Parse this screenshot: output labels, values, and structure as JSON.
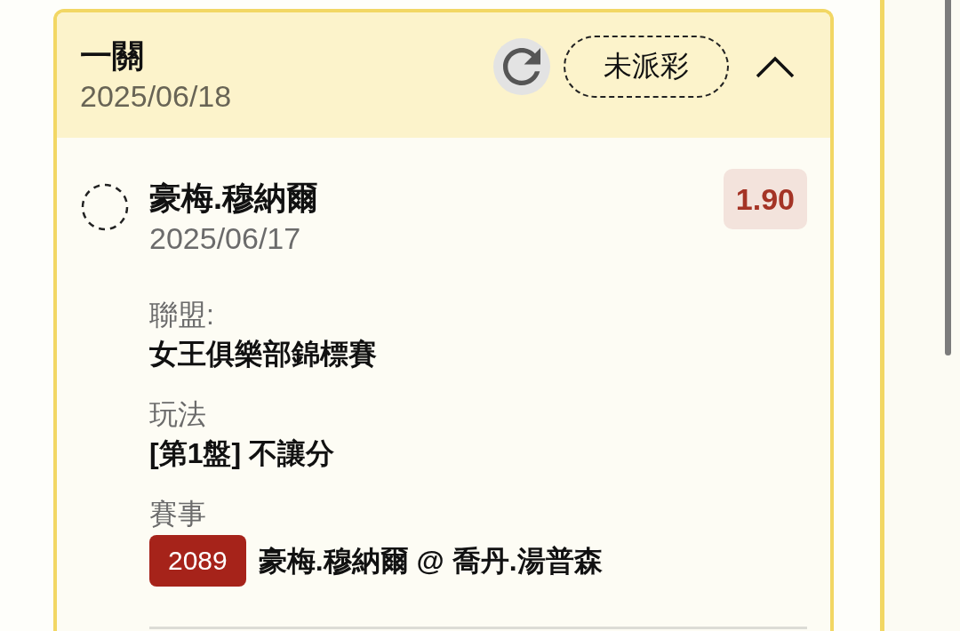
{
  "bet": {
    "type": "一關",
    "date": "2025/06/18",
    "status": "未派彩",
    "expanded": true
  },
  "selections": [
    {
      "name": "豪梅.穆納爾",
      "date": "2025/06/17",
      "odds": "1.90",
      "settled": false,
      "fields": [
        {
          "label": "聯盟:",
          "value": "女王俱樂部錦標賽"
        },
        {
          "label": "玩法",
          "value": "[第1盤] 不讓分"
        },
        {
          "label": "賽事",
          "match_no": "2089",
          "value": "豪梅.穆納爾 @ 喬丹.湯普森"
        }
      ]
    }
  ]
}
